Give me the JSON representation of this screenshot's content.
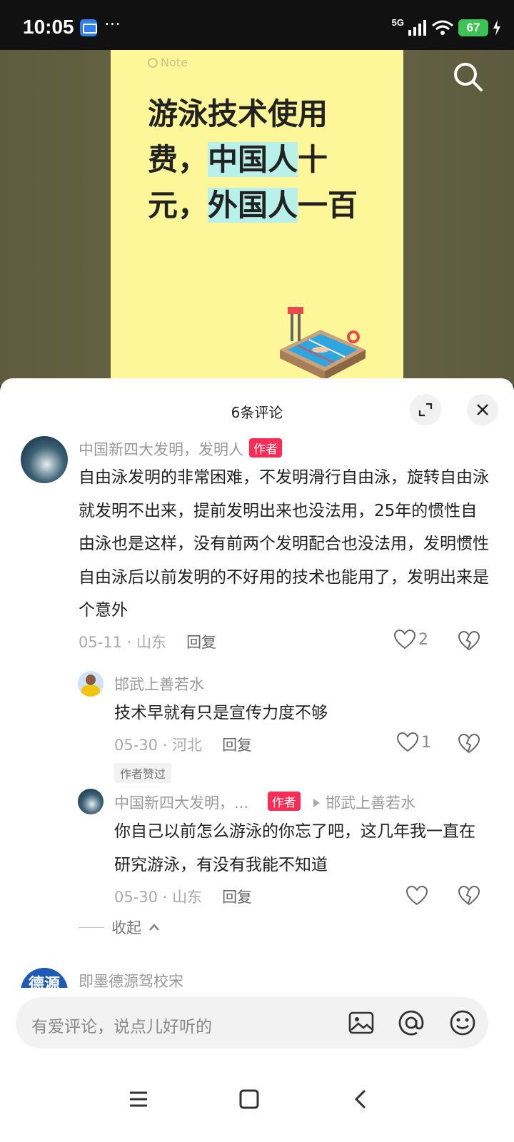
{
  "status_bar": {
    "time": "10:05",
    "more": "···",
    "network": "5G",
    "battery": "67",
    "icons": [
      "wallet-icon",
      "signal-icon",
      "wifi-icon",
      "battery-icon",
      "charging-icon"
    ]
  },
  "media": {
    "note_logo": "Note",
    "title_parts": {
      "p1": "游泳技术使用费，",
      "p2": "中国人",
      "p3": "十元，",
      "p4": "外国人",
      "p5": "一百"
    }
  },
  "sheet": {
    "title": "6条评论"
  },
  "comments": [
    {
      "author": "中国新四大发明，发明人",
      "tag": "作者",
      "text": "自由泳发明的非常困难，不发明滑行自由泳，旋转自由泳就发明不出来，提前发明出来也没法用，25年的惯性自由泳也是这样，没有前两个发明配合也没法用，发明惯性自由泳后以前发明的不好用的技术也能用了，发明出来是个意外",
      "date": "05-11",
      "location": "山东",
      "reply_label": "回复",
      "likes": "2"
    },
    {
      "author": "邯武上善若水",
      "text": "技术早就有只是宣传力度不够",
      "date": "05-30",
      "location": "河北",
      "reply_label": "回复",
      "likes": "1",
      "badge": "作者赞过"
    },
    {
      "author": "中国新四大发明，...",
      "tag": "作者",
      "reply_to": "邯武上善若水",
      "text": "你自己以前怎么游泳的你忘了吧，这几年我一直在研究游泳，有没有我能不知道",
      "date": "05-30",
      "location": "山东",
      "reply_label": "回复"
    },
    {
      "author": "即墨德源驾校宋",
      "avatar_text": "德源"
    }
  ],
  "collapse_label": "收起",
  "input": {
    "placeholder": "有爱评论，说点儿好听的"
  },
  "colors": {
    "accent": "#fe2c55",
    "note_bg": "#fdf79a",
    "highlight": "#b8f1e9"
  }
}
